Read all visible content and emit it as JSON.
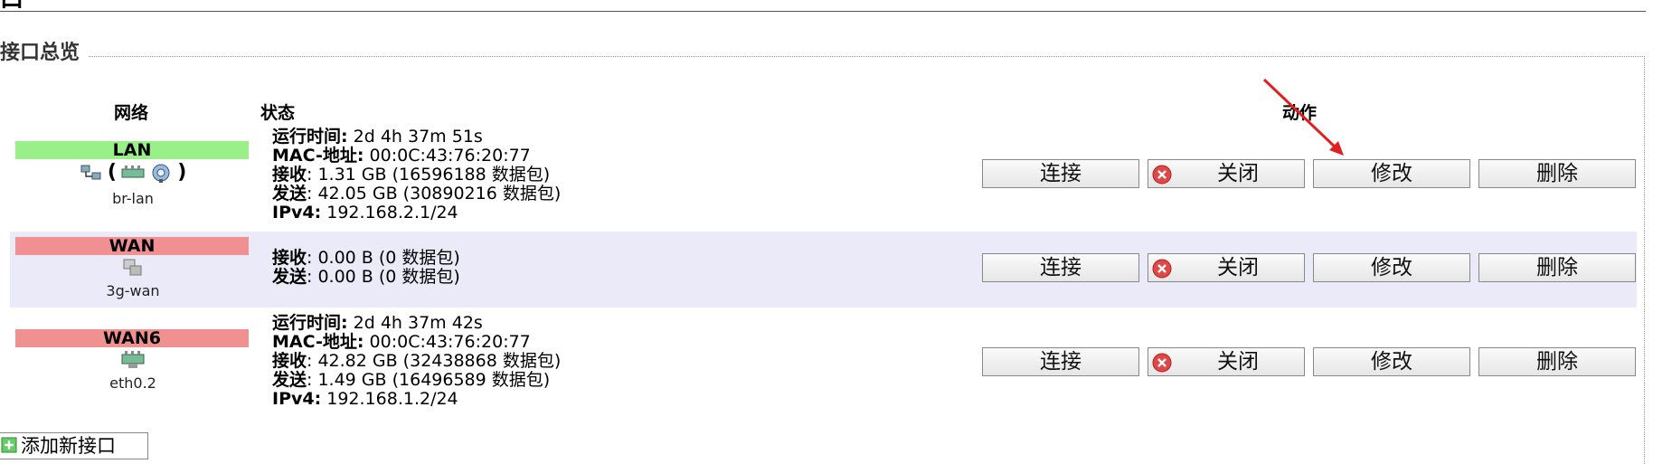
{
  "page": {
    "top_glyph": "口"
  },
  "section": {
    "title": "接口总览"
  },
  "table": {
    "headers": {
      "network": "网络",
      "status": "状态",
      "actions": "动作"
    },
    "rows": [
      {
        "badge": "LAN",
        "badge_color": "#99ef88",
        "device": "br-lan",
        "lines": [
          {
            "label": "运行时间:",
            "value": " 2d 4h 37m 51s"
          },
          {
            "label": "MAC-地址:",
            "value": " 00:0C:43:76:20:77"
          },
          {
            "label": "接收",
            "value": ": 1.31 GB (16596188 数据包)"
          },
          {
            "label": "发送",
            "value": ": 42.05 GB (30890216 数据包)"
          },
          {
            "label": "IPv4:",
            "value": " 192.168.2.1/24"
          }
        ]
      },
      {
        "badge": "WAN",
        "badge_color": "#f09090",
        "device": "3g-wan",
        "lines": [
          {
            "label": "接收",
            "value": ": 0.00 B (0 数据包)"
          },
          {
            "label": "发送",
            "value": ": 0.00 B (0 数据包)"
          }
        ]
      },
      {
        "badge": "WAN6",
        "badge_color": "#f09090",
        "device": "eth0.2",
        "lines": [
          {
            "label": "运行时间:",
            "value": " 2d 4h 37m 42s"
          },
          {
            "label": "MAC-地址:",
            "value": " 00:0C:43:76:20:77"
          },
          {
            "label": "接收",
            "value": ": 42.82 GB (32438868 数据包)"
          },
          {
            "label": "发送",
            "value": ": 1.49 GB (16496589 数据包)"
          },
          {
            "label": "IPv4:",
            "value": " 192.168.1.2/24"
          }
        ]
      }
    ]
  },
  "actions": {
    "connect": "连接",
    "close": "关闭",
    "edit": "修改",
    "delete": "删除"
  },
  "add_interface": {
    "label": "添加新接口"
  },
  "colors": {
    "alt_row": "#ebeaf8",
    "annotation_arrow": "#e02020"
  }
}
